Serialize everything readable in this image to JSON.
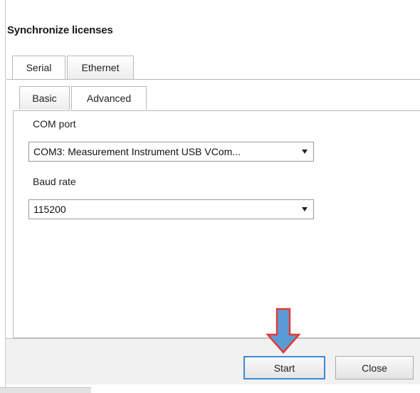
{
  "dialog": {
    "title": "Synchronize licenses"
  },
  "outer_tabs": [
    {
      "label": "Serial",
      "active": true
    },
    {
      "label": "Ethernet",
      "active": false
    }
  ],
  "inner_tabs": [
    {
      "label": "Basic",
      "active": false
    },
    {
      "label": "Advanced",
      "active": true
    }
  ],
  "fields": {
    "com_port": {
      "label": "COM port",
      "value": "COM3: Measurement Instrument USB VCom..."
    },
    "baud_rate": {
      "label": "Baud rate",
      "value": "115200"
    }
  },
  "buttons": {
    "start": "Start",
    "close": "Close"
  },
  "annotation": {
    "arrow_color": "#5b9bd5",
    "arrow_outline": "#e53935"
  }
}
